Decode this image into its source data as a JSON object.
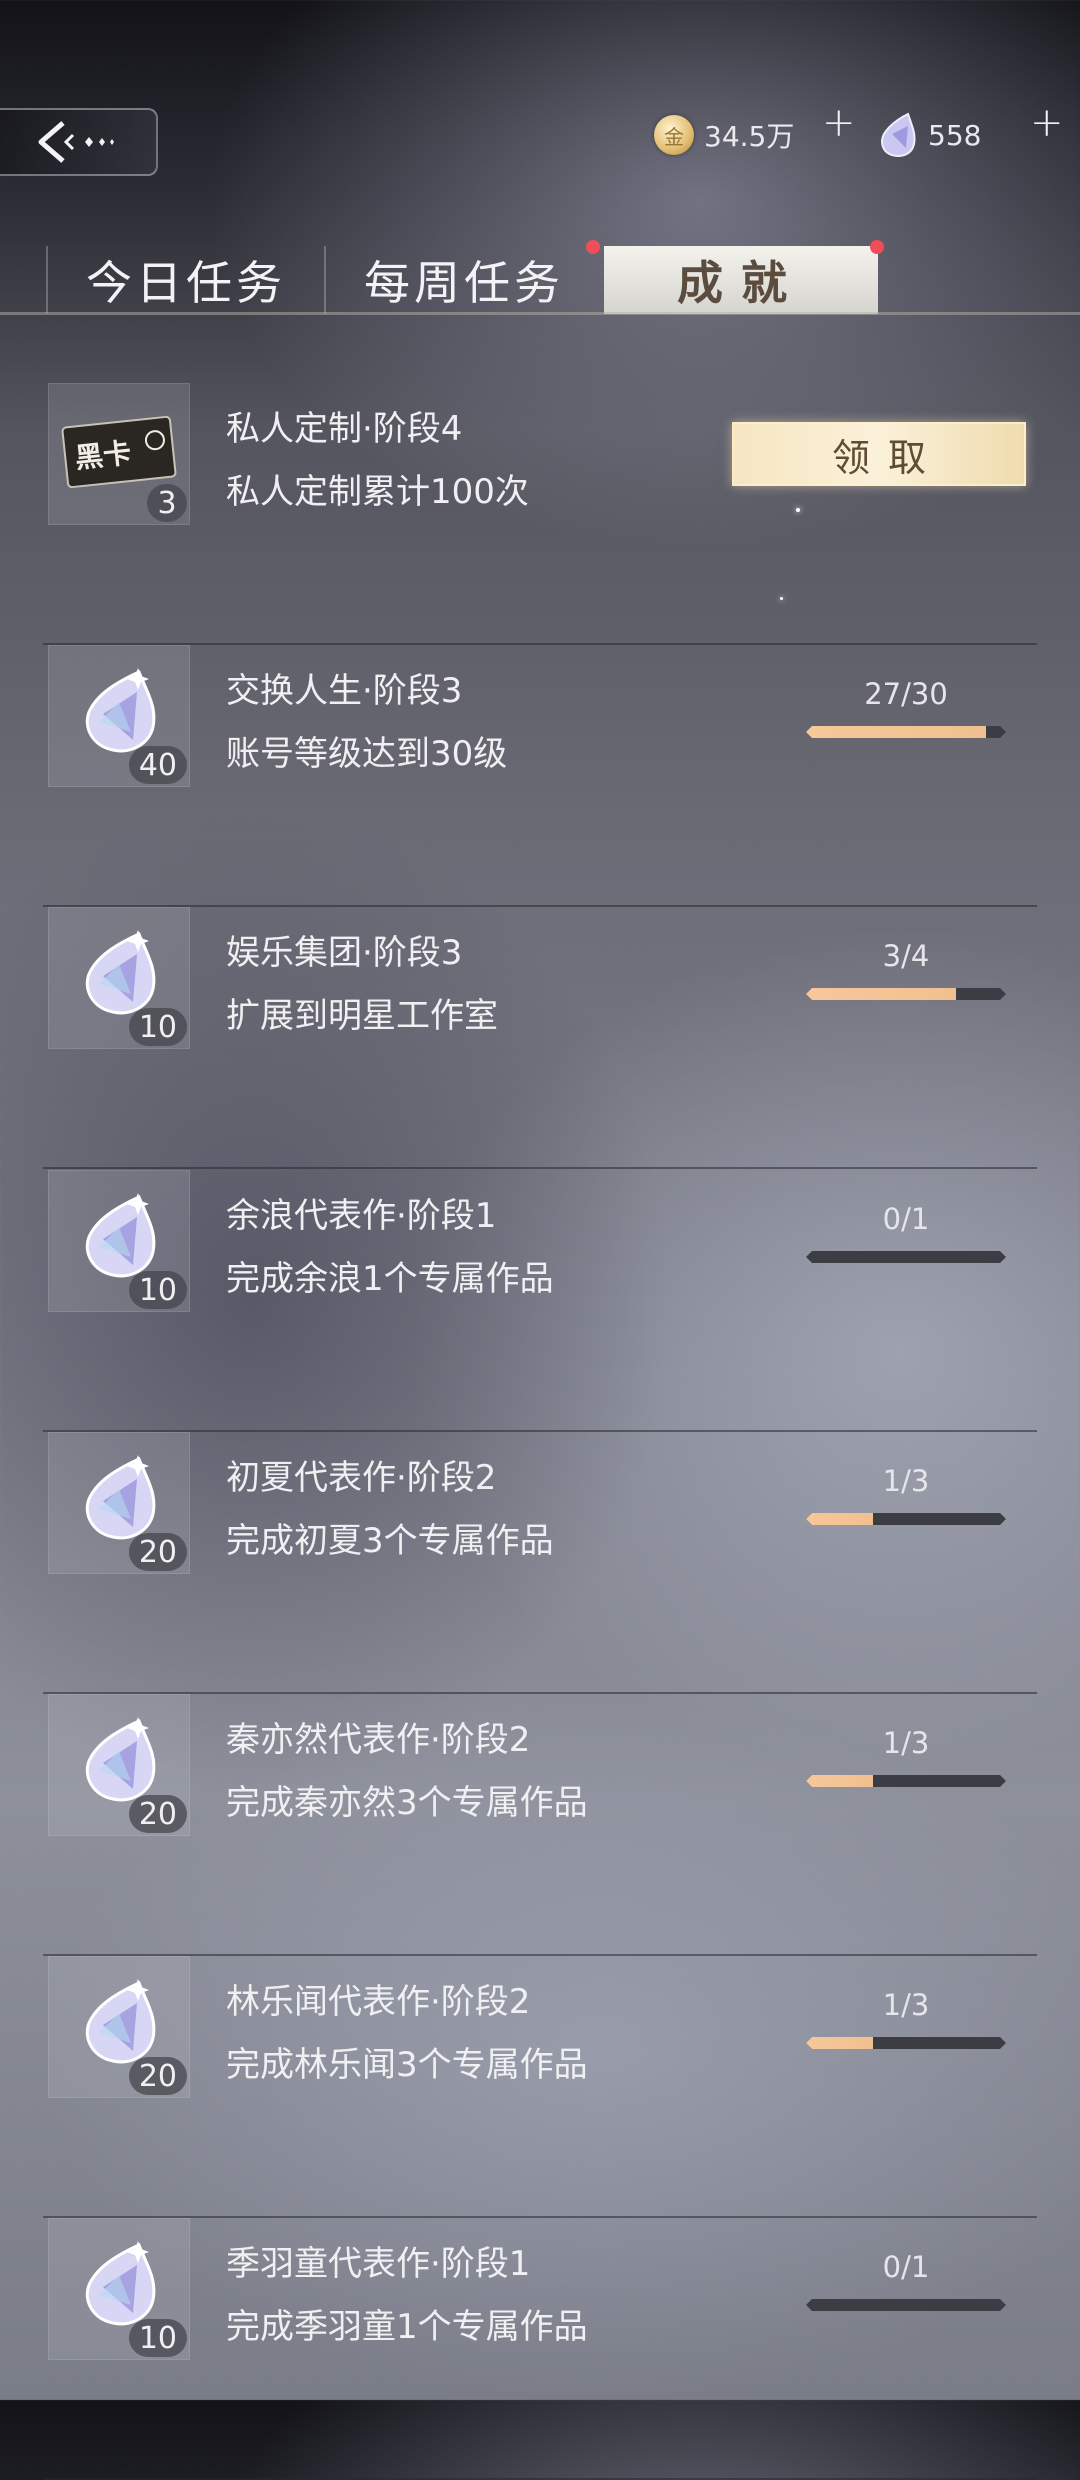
{
  "header": {
    "gold": {
      "icon": "gold-coin-icon",
      "value": "34.5万"
    },
    "diamond": {
      "icon": "diamond-icon",
      "value": "558"
    },
    "plus": "+"
  },
  "tabs": [
    {
      "label": "今日任务",
      "active": false,
      "dot": false
    },
    {
      "label": "每周任务",
      "active": false,
      "dot": true
    },
    {
      "label": "成就",
      "active": true,
      "dot": true
    }
  ],
  "claim_label": "领取",
  "tasks": [
    {
      "title": "私人定制·阶段4",
      "desc": "私人定制累计100次",
      "reward_icon": "black-card-icon",
      "reward_label": "黑卡",
      "count": "3",
      "claimable": true
    },
    {
      "title": "交换人生·阶段3",
      "desc": "账号等级达到30级",
      "reward_icon": "diamond-icon",
      "count": "40",
      "progress_text": "27/30",
      "progress": 0.9
    },
    {
      "title": "娱乐集团·阶段3",
      "desc": "扩展到明星工作室",
      "reward_icon": "diamond-icon",
      "count": "10",
      "progress_text": "3/4",
      "progress": 0.75
    },
    {
      "title": "余浪代表作·阶段1",
      "desc": "完成余浪1个专属作品",
      "reward_icon": "diamond-icon",
      "count": "10",
      "progress_text": "0/1",
      "progress": 0
    },
    {
      "title": "初夏代表作·阶段2",
      "desc": "完成初夏3个专属作品",
      "reward_icon": "diamond-icon",
      "count": "20",
      "progress_text": "1/3",
      "progress": 0.3333
    },
    {
      "title": "秦亦然代表作·阶段2",
      "desc": "完成秦亦然3个专属作品",
      "reward_icon": "diamond-icon",
      "count": "20",
      "progress_text": "1/3",
      "progress": 0.3333
    },
    {
      "title": "林乐闻代表作·阶段2",
      "desc": "完成林乐闻3个专属作品",
      "reward_icon": "diamond-icon",
      "count": "20",
      "progress_text": "1/3",
      "progress": 0.3333
    },
    {
      "title": "季羽童代表作·阶段1",
      "desc": "完成季羽童1个专属作品",
      "reward_icon": "diamond-icon",
      "count": "10",
      "progress_text": "0/1",
      "progress": 0
    }
  ]
}
